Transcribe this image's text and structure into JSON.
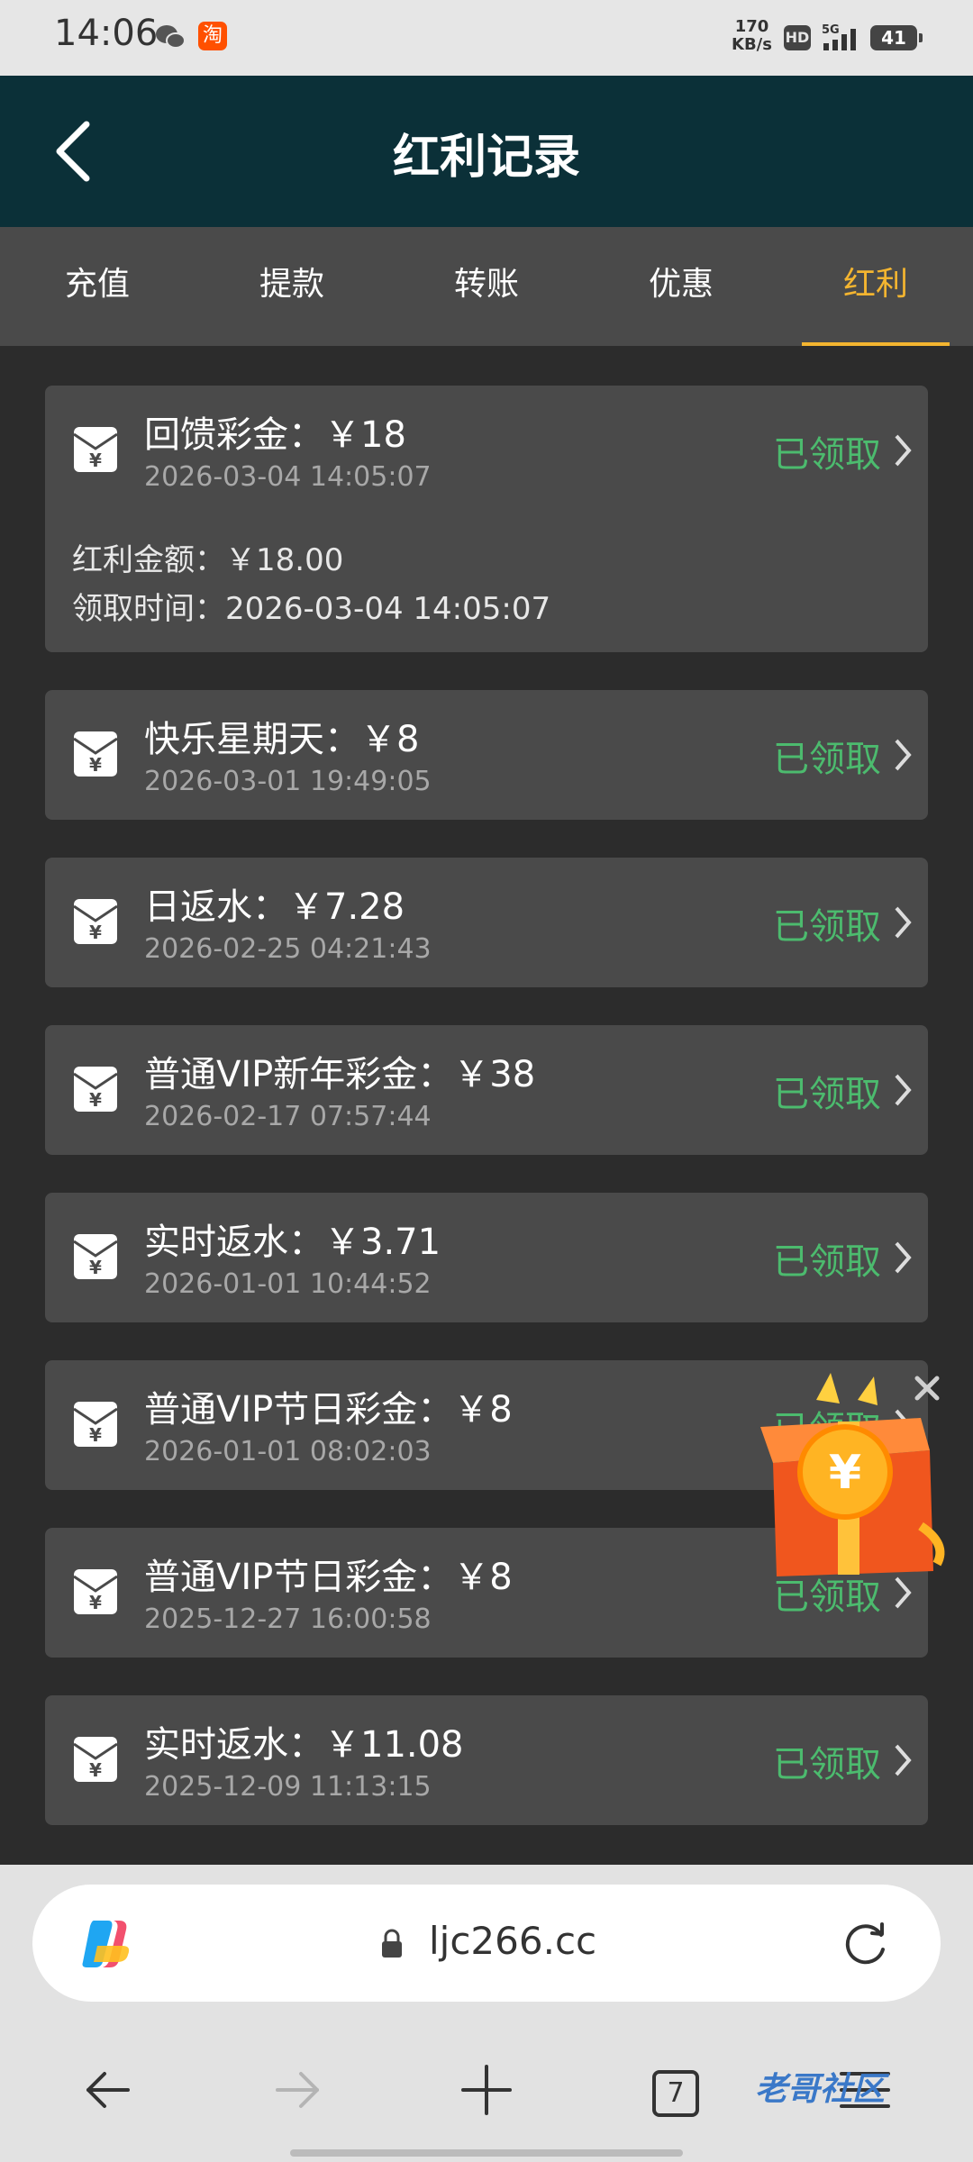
{
  "status_bar": {
    "time": "14:06",
    "net_speed_value": "170",
    "net_speed_unit": "KB/s",
    "hd": "HD",
    "network": "5G",
    "battery": "41",
    "icons": [
      "wechat-icon",
      "taobao-icon",
      "signal-icon"
    ]
  },
  "header": {
    "title": "红利记录"
  },
  "tabs": [
    {
      "label": "充值"
    },
    {
      "label": "提款"
    },
    {
      "label": "转账"
    },
    {
      "label": "优惠"
    },
    {
      "label": "红利",
      "active": true
    }
  ],
  "records": [
    {
      "title": "回馈彩金：￥18",
      "time": "2026-03-04 14:05:07",
      "status": "已领取",
      "expanded": true,
      "amount_label": "红利金额：￥18.00",
      "claim_label": "领取时间：2026-03-04 14:05:07"
    },
    {
      "title": "快乐星期天：￥8",
      "time": "2026-03-01 19:49:05",
      "status": "已领取"
    },
    {
      "title": "日返水：￥7.28",
      "time": "2026-02-25 04:21:43",
      "status": "已领取"
    },
    {
      "title": "普通VIP新年彩金：￥38",
      "time": "2026-02-17 07:57:44",
      "status": "已领取"
    },
    {
      "title": "实时返水：￥3.71",
      "time": "2026-01-01 10:44:52",
      "status": "已领取"
    },
    {
      "title": "普通VIP节日彩金：￥8",
      "time": "2026-01-01 08:02:03",
      "status": "已领取"
    },
    {
      "title": "普通VIP节日彩金：￥8",
      "time": "2025-12-27 16:00:58",
      "status": "已领取"
    },
    {
      "title": "实时返水：￥11.08",
      "time": "2025-12-09 11:13:15",
      "status": "已领取"
    }
  ],
  "browser": {
    "url": "ljc266.cc",
    "tab_count": "7"
  },
  "watermark": "老哥社区",
  "colors": {
    "header_bg": "#0b3038",
    "tab_active": "#f4b530",
    "status_green": "#4cbb6e",
    "card_bg": "#4a4a4a",
    "page_bg": "#2c2c2c"
  }
}
